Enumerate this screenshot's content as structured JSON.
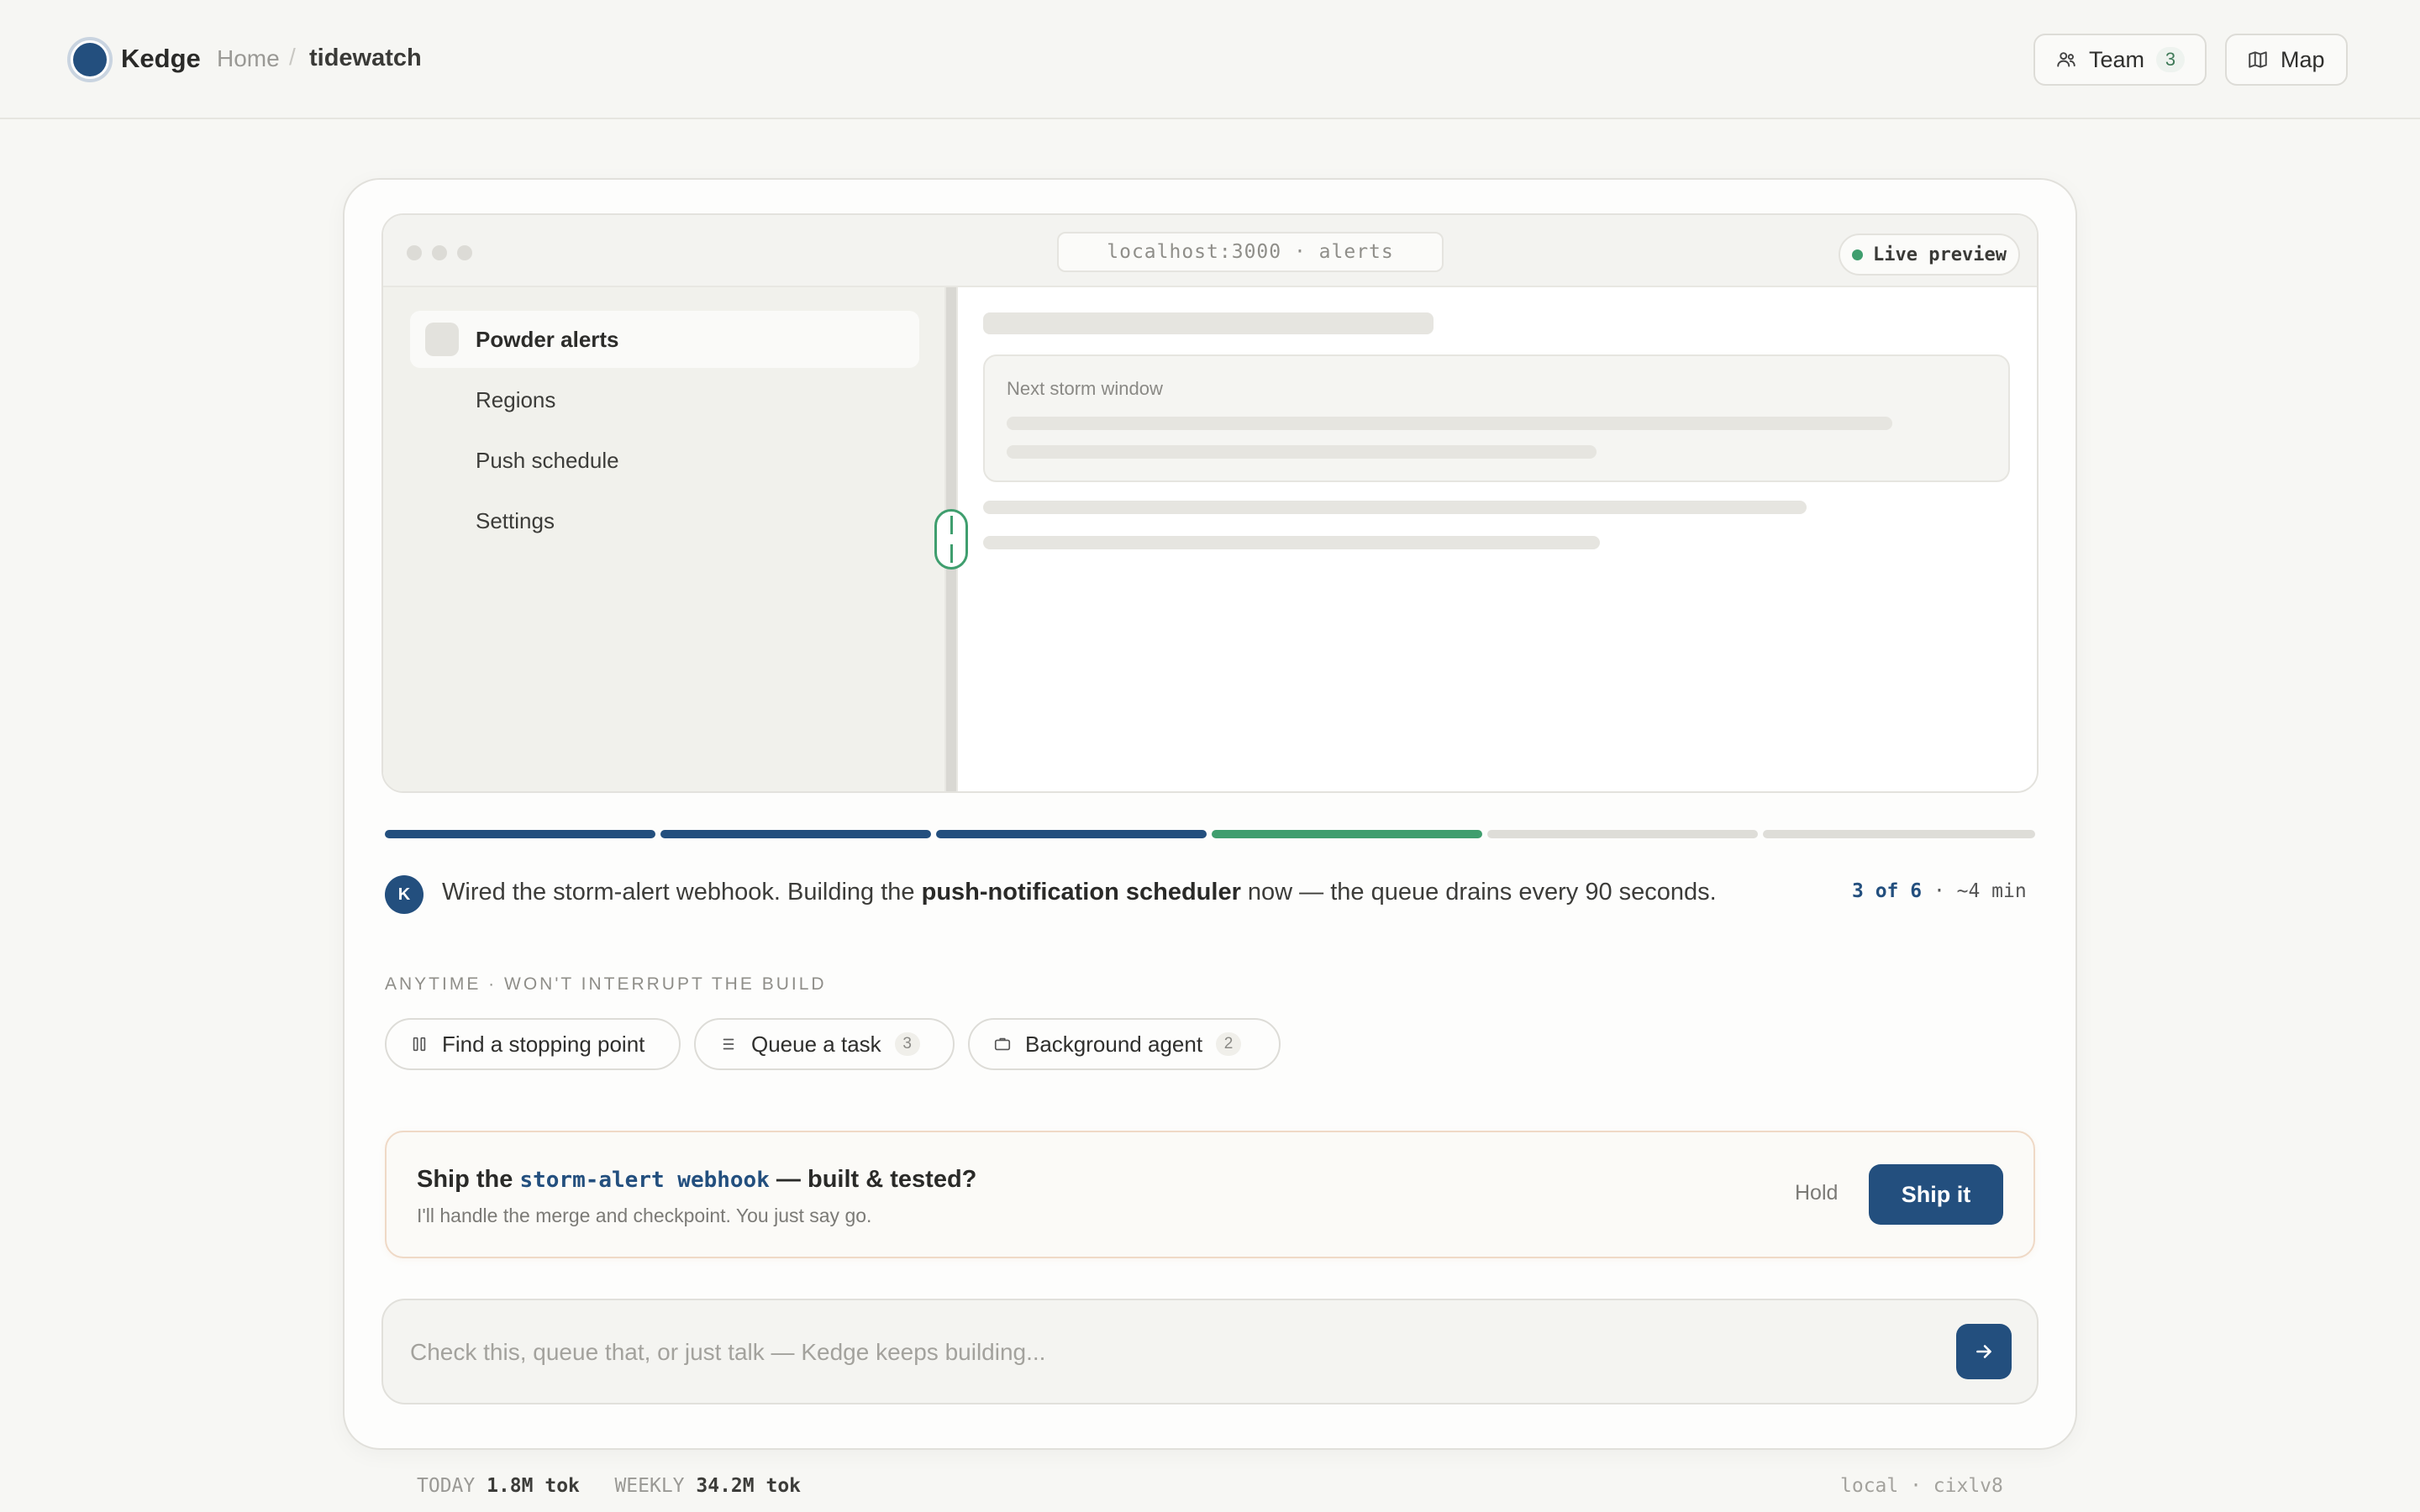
{
  "header": {
    "brand": "Kedge",
    "breadcrumb_home": "Home",
    "breadcrumb_sep": "/",
    "project": "tidewatch",
    "team_label": "Team",
    "team_count": "3",
    "map_label": "Map"
  },
  "preview": {
    "url": "localhost:3000 · alerts",
    "live_label": "Live preview",
    "nav_items": [
      {
        "label": "Powder alerts"
      },
      {
        "label": "Regions"
      },
      {
        "label": "Push schedule"
      },
      {
        "label": "Settings"
      }
    ],
    "card_label": "Next storm window"
  },
  "progress": {
    "total_steps": 6,
    "completed_steps": 3,
    "active_step": 4,
    "colors": {
      "done": "#234f7e",
      "active": "#3f9e6e",
      "pending": "#deddd8"
    }
  },
  "status": {
    "avatar_initial": "K",
    "text_before": "Wired the storm-alert webhook. Building the ",
    "text_bold": "push-notification scheduler",
    "text_after": " now — the queue drains every 90 seconds.",
    "step_current": "3 of 6",
    "step_eta": " · ~4 min"
  },
  "anytime": {
    "label": "ANYTIME · WON'T INTERRUPT THE BUILD",
    "chips": [
      {
        "label": "Find a stopping point",
        "icon": "pause-icon"
      },
      {
        "label": "Queue a task",
        "icon": "list-icon",
        "count": "3"
      },
      {
        "label": "Background agent",
        "icon": "briefcase-icon",
        "count": "2"
      }
    ]
  },
  "ship": {
    "title_before": "Ship the ",
    "title_code": "storm-alert webhook",
    "title_after": " — built & tested?",
    "subtitle": "I'll handle the merge and checkpoint. You just say go.",
    "hold_label": "Hold",
    "ship_label": "Ship it"
  },
  "composer": {
    "placeholder": "Check this, queue that, or just talk — Kedge keeps building..."
  },
  "footer": {
    "today_label": "TODAY",
    "today_value": "1.8M tok",
    "weekly_label": "WEEKLY",
    "weekly_value": "34.2M tok",
    "env": "local · cixlv8"
  },
  "colors": {
    "accent": "#234f7e",
    "live": "#3f9e6e"
  }
}
